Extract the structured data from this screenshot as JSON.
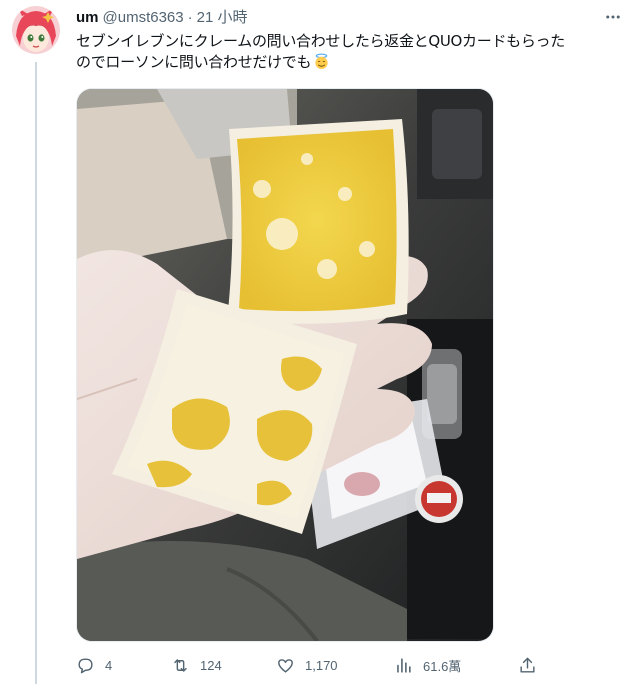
{
  "tweet": {
    "author_name": "um",
    "author_handle": "@umst6363",
    "separator": "·",
    "time": "21 小時",
    "text_line1": "セブンイレブンにクレームの問い合わせしたら返金とQUOカードもらった",
    "text_line2": "のでローソンに問い合わせだけでも",
    "emoji": "smiling-face-with-halo-emoji"
  },
  "actions": {
    "replies": "4",
    "retweets": "124",
    "likes": "1,170",
    "views": "61.6萬"
  },
  "icons": {
    "more": "more-horizontal-icon",
    "reply": "reply-icon",
    "retweet": "retweet-icon",
    "like": "heart-icon",
    "views": "views-chart-icon",
    "share": "share-icon"
  },
  "colors": {
    "text": "#0f1419",
    "secondary": "#536471",
    "thread_line": "#cfd9de",
    "bread_crust": "#f4efe0",
    "egg_yellow": "#e8c53a"
  }
}
